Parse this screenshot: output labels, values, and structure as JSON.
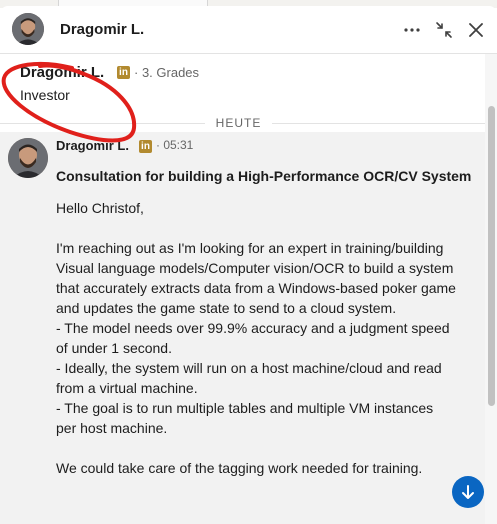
{
  "header": {
    "name": "Dragomir L.",
    "icons": {
      "more": "more-horizontal-icon",
      "collapse": "collapse-arrows-icon",
      "close": "close-icon"
    }
  },
  "profile": {
    "name": "Dragomir L.",
    "badge": "in",
    "degree": "· 3. Grades",
    "headline": "Investor"
  },
  "divider": {
    "label": "HEUTE"
  },
  "message": {
    "sender": "Dragomir L.",
    "badge": "in",
    "time": "· 05:31",
    "subject": "Consultation for building a High-Performance OCR/CV System",
    "body": [
      "Hello Christof,",
      "",
      "I'm reaching out as I'm looking for an expert in training/building Visual language models/Computer vision/OCR to build a system that accurately extracts data from a Windows-based poker game and updates the game state to send to a cloud system.",
      "- The model needs over 99.9% accuracy and a judgment speed of under 1 second.",
      "- Ideally, the system will run on a host machine/cloud and read from a virtual machine.",
      "- The goal is to run multiple tables and multiple VM instances per host machine.",
      "",
      "We could take care of the tagging work needed for training."
    ]
  },
  "colors": {
    "accent": "#0a66c2",
    "annotation": "#e0201b",
    "message_bg": "#f2f2f2",
    "premium_badge": "#b28a2f"
  }
}
